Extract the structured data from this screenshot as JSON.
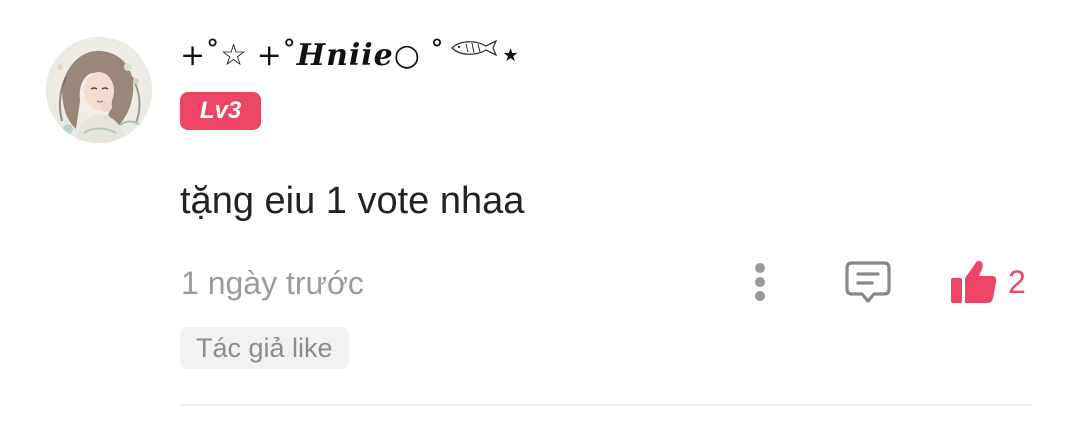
{
  "comment": {
    "author": {
      "name_prefix": "+˚☆ +˚",
      "name": "Hniie",
      "name_suffix": "○ ˚",
      "name_end": "★",
      "level": "Lv3"
    },
    "text": "tặng eiu 1 vote nhaa",
    "timestamp": "1 ngày trước",
    "like_count": "2",
    "author_like_tag": "Tác giả like"
  },
  "icons": {
    "avatar": "avatar-image",
    "more": "more-vertical-icon",
    "reply": "comment-reply-icon",
    "like": "thumbs-up-icon",
    "fish": "fish-icon"
  },
  "colors": {
    "accent": "#ec4566",
    "muted_text": "#9b9b9b",
    "primary_text": "#222222",
    "tag_background": "#f2f2f2"
  }
}
